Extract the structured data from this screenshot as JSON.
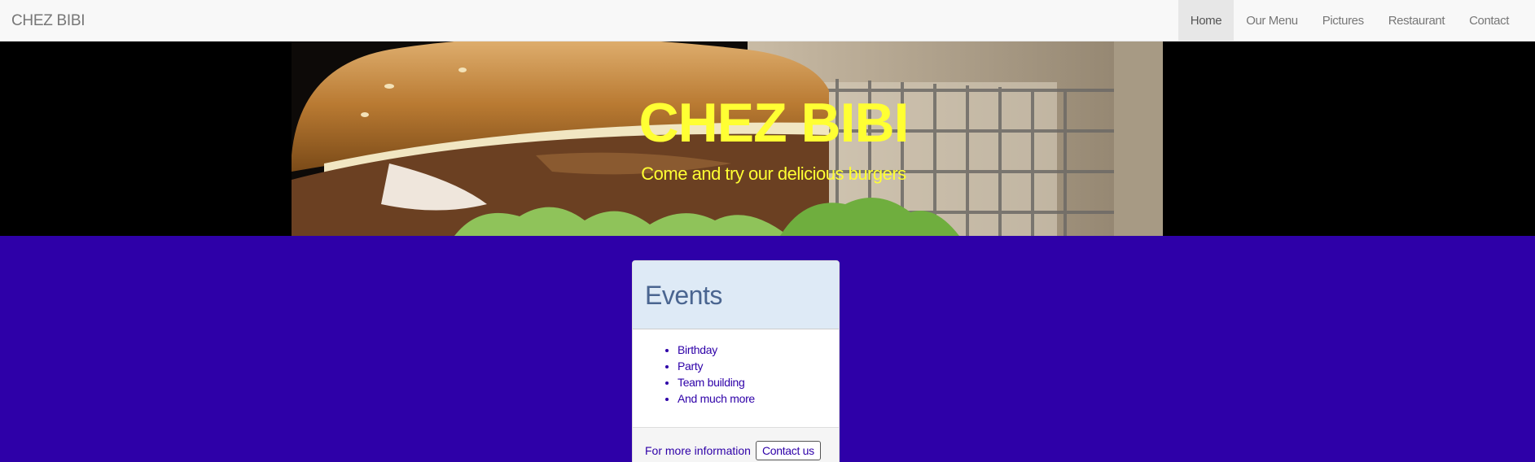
{
  "navbar": {
    "brand": "CHEZ BIBI",
    "items": [
      {
        "label": "Home",
        "active": true
      },
      {
        "label": "Our Menu",
        "active": false
      },
      {
        "label": "Pictures",
        "active": false
      },
      {
        "label": "Restaurant",
        "active": false
      },
      {
        "label": "Contact",
        "active": false
      }
    ]
  },
  "hero": {
    "title": "CHEZ BIBI",
    "subtitle": "Come and try our delicious burgers",
    "title_color": "#ffff33"
  },
  "events": {
    "title": "Events",
    "items": [
      "Birthday",
      "Party",
      "Team building",
      "And much more"
    ],
    "footer_text": "For more information",
    "button_label": "Contact us"
  },
  "colors": {
    "page_background": "#2e00a8",
    "panel_heading": "#deeaf6",
    "navbar": "#f8f8f8"
  }
}
